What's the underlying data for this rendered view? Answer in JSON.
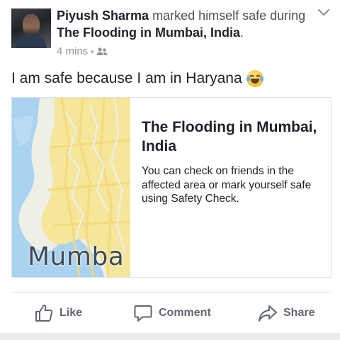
{
  "post": {
    "author": "Piyush Sharma",
    "action_text": " marked himself safe during ",
    "event_name": "The Flooding in Mumbai, India",
    "punctuation": ".",
    "time": "4 mins",
    "separator": "•",
    "audience_icon": "friends-icon",
    "status_text": "I am safe because I am in Haryana",
    "status_emoji": "tears-of-joy-emoji-icon"
  },
  "card": {
    "map_label": "Mumba",
    "title": "The Flooding in Mumbai, India",
    "description": "You can check on friends in the affected area or mark yourself safe using Safety Check."
  },
  "actions": {
    "like": "Like",
    "comment": "Comment",
    "share": "Share"
  },
  "colors": {
    "text_primary": "#1d2129",
    "text_secondary": "#90949c",
    "action_gray": "#606770",
    "map_water": "#a9d3f0",
    "map_roads": "#f6e69a"
  }
}
